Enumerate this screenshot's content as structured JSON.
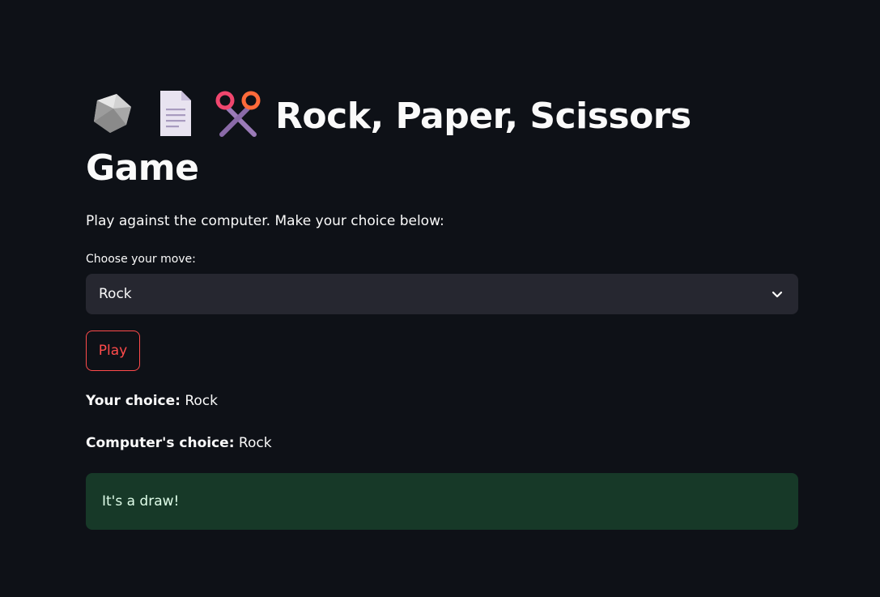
{
  "header": {
    "title_text": "Rock, Paper, Scissors Game",
    "emoji_icons": [
      "rock-icon",
      "page-icon",
      "scissors-icon"
    ]
  },
  "intro": {
    "text": "Play against the computer. Make your choice below:"
  },
  "move_select": {
    "label": "Choose your move:",
    "selected_value": "Rock"
  },
  "play_button": {
    "label": "Play"
  },
  "results": {
    "your_choice_label": "Your choice:",
    "your_choice_value": "Rock",
    "computer_choice_label": "Computer's choice:",
    "computer_choice_value": "Rock"
  },
  "outcome": {
    "message": "It's a draw!"
  },
  "colors": {
    "background": "#0e1117",
    "select_bg": "#262730",
    "accent": "#ff4b4b",
    "success_bg": "#173928",
    "success_text": "#dffde9"
  }
}
